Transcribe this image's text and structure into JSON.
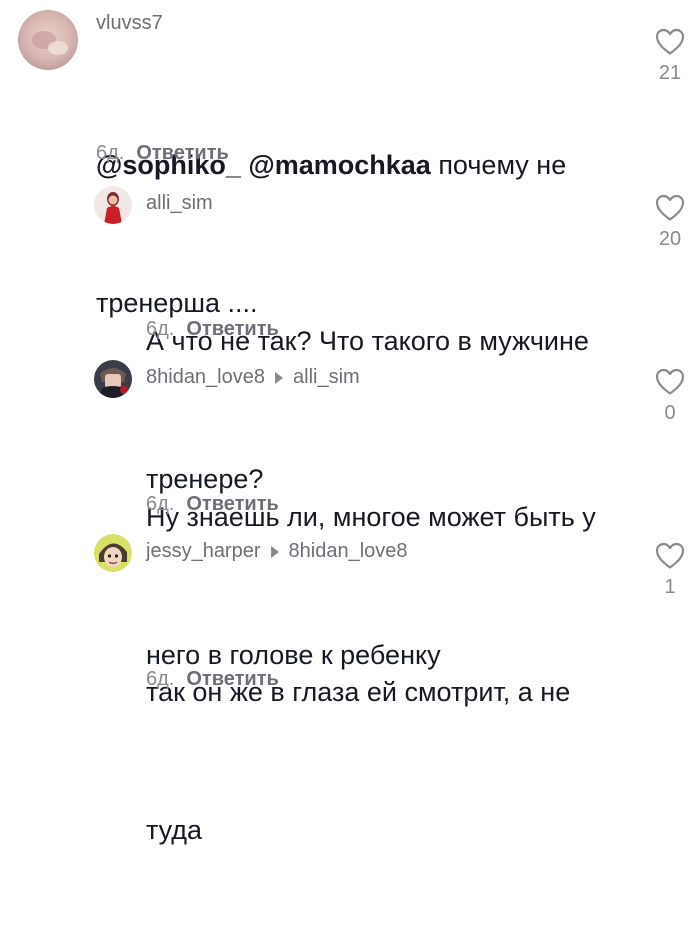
{
  "comments": [
    {
      "username": "vluvss7",
      "reply_to": "",
      "mentions": [
        "@sophiko_",
        "@mamochkaa"
      ],
      "text_line1": "почему не",
      "text_line2": "тренерша ....",
      "age": "6д.",
      "reply_label": "Ответить",
      "likes": "21",
      "avatar_icon": "blurred-portrait-avatar"
    },
    {
      "username": "alli_sim",
      "reply_to": "",
      "text_line1": "А что не так? Что такого в мужчине",
      "text_line2": "тренере?",
      "age": "6д.",
      "reply_label": "Ответить",
      "likes": "20",
      "avatar_icon": "red-outfit-avatar"
    },
    {
      "username": "8hidan_love8",
      "reply_to": "alli_sim",
      "text_line1": "Ну знаешь ли, многое может быть у",
      "text_line2": "него в голове к ребенку",
      "age": "6д.",
      "reply_label": "Ответить",
      "likes": "0",
      "avatar_icon": "anime-character-avatar"
    },
    {
      "username": "jessy_harper",
      "reply_to": "8hidan_love8",
      "text_line1": "так он же в глаза ей смотрит, а не",
      "text_line2": "туда",
      "age": "6д.",
      "reply_label": "Ответить",
      "likes": "1",
      "avatar_icon": "cartoon-face-avatar"
    }
  ],
  "colors": {
    "text": "#161823",
    "secondary": "#8a8b91",
    "username": "#6e6f76",
    "heart_stroke": "#8a8b91"
  }
}
